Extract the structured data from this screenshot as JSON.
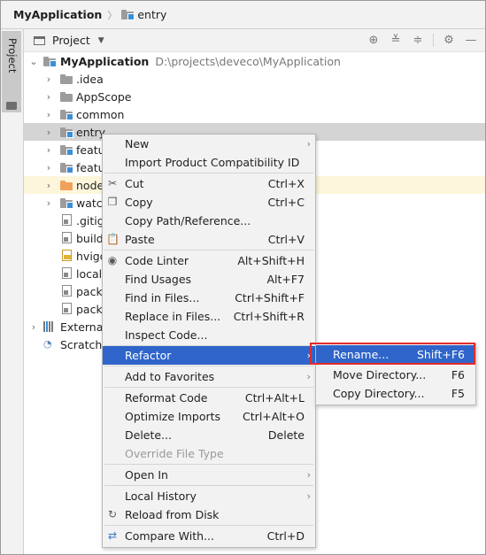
{
  "breadcrumb": {
    "root": "MyApplication",
    "separator": "〉",
    "current": "entry"
  },
  "side_stripe": {
    "tab_label": "Project"
  },
  "project_toolbar": {
    "title": "Project",
    "caret_icon": "dropdown-caret-icon",
    "icons": [
      "locate-icon",
      "expand-all-icon",
      "collapse-all-icon",
      "gear-icon",
      "hide-icon"
    ]
  },
  "tree": {
    "root": {
      "name": "MyApplication",
      "path": "D:\\projects\\deveco\\MyApplication"
    },
    "items": [
      {
        "label": ".idea"
      },
      {
        "label": "AppScope"
      },
      {
        "label": "common"
      },
      {
        "label": "entry"
      },
      {
        "label": "featu"
      },
      {
        "label": "featu"
      },
      {
        "label": "node"
      },
      {
        "label": "watch"
      },
      {
        "label": ".gitig"
      },
      {
        "label": "build"
      },
      {
        "label": "hvigo"
      },
      {
        "label": "local."
      },
      {
        "label": "packa"
      },
      {
        "label": "packa"
      },
      {
        "label": "External"
      },
      {
        "label": "Scratche"
      }
    ]
  },
  "context_menu": {
    "items": [
      {
        "label": "New",
        "shortcut": ""
      },
      {
        "label": "Import Product Compatibility ID",
        "shortcut": ""
      },
      {
        "label": "Cut",
        "shortcut": "Ctrl+X"
      },
      {
        "label": "Copy",
        "shortcut": "Ctrl+C"
      },
      {
        "label": "Copy Path/Reference...",
        "shortcut": ""
      },
      {
        "label": "Paste",
        "shortcut": "Ctrl+V"
      },
      {
        "label": "Code Linter",
        "shortcut": "Alt+Shift+H"
      },
      {
        "label": "Find Usages",
        "shortcut": "Alt+F7"
      },
      {
        "label": "Find in Files...",
        "shortcut": "Ctrl+Shift+F"
      },
      {
        "label": "Replace in Files...",
        "shortcut": "Ctrl+Shift+R"
      },
      {
        "label": "Inspect Code...",
        "shortcut": ""
      },
      {
        "label": "Refactor",
        "shortcut": ""
      },
      {
        "label": "Add to Favorites",
        "shortcut": ""
      },
      {
        "label": "Reformat Code",
        "shortcut": "Ctrl+Alt+L"
      },
      {
        "label": "Optimize Imports",
        "shortcut": "Ctrl+Alt+O"
      },
      {
        "label": "Delete...",
        "shortcut": "Delete"
      },
      {
        "label": "Override File Type",
        "shortcut": ""
      },
      {
        "label": "Open In",
        "shortcut": ""
      },
      {
        "label": "Local History",
        "shortcut": ""
      },
      {
        "label": "Reload from Disk",
        "shortcut": ""
      },
      {
        "label": "Compare With...",
        "shortcut": "Ctrl+D"
      }
    ]
  },
  "refactor_submenu": {
    "items": [
      {
        "label": "Rename...",
        "shortcut": "Shift+F6"
      },
      {
        "label": "Move Directory...",
        "shortcut": "F6"
      },
      {
        "label": "Copy Directory...",
        "shortcut": "F5"
      }
    ]
  },
  "colors": {
    "selection": "#2f65ca",
    "highlight_border": "#e52a2a",
    "tree_selection": "#d4d4d4"
  }
}
